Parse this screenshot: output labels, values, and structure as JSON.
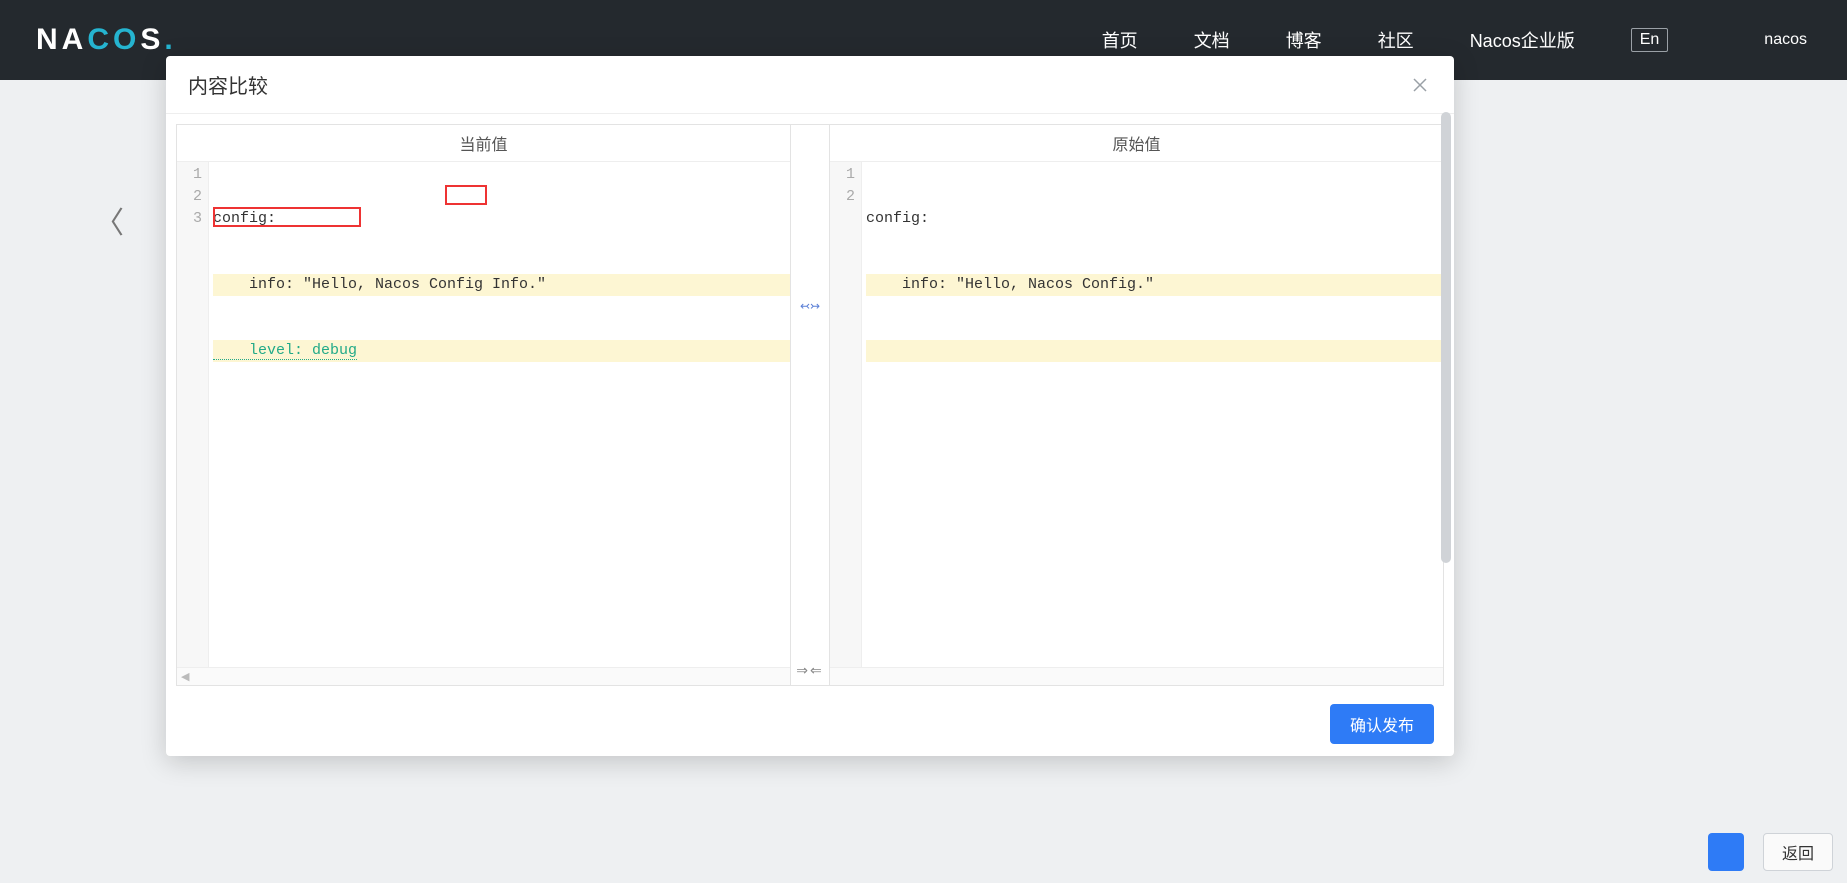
{
  "topbar": {
    "logo_left": "NA",
    "logo_mid": "CO",
    "logo_right": "S",
    "logo_dot": ".",
    "nav": {
      "home": "首页",
      "docs": "文档",
      "blog": "博客",
      "community": "社区",
      "enterprise": "Nacos企业版"
    },
    "lang": "En",
    "user": "nacos"
  },
  "page": {
    "back_icon": "〈",
    "bottom_blue_hidden": "",
    "bottom_back": "返回"
  },
  "modal": {
    "title": "内容比较",
    "left_header": "当前值",
    "right_header": "原始值",
    "publish": "确认发布",
    "center_marker_top": "↢↣",
    "center_marker_bottom": "⇒⇐"
  },
  "diff": {
    "left": {
      "lines": [
        {
          "n": "1",
          "text": "config:"
        },
        {
          "n": "2",
          "text": "    info: \"Hello, Nacos Config Info.\"",
          "hl": "yellow"
        },
        {
          "n": "3",
          "text": "    level: debug",
          "hl": "green",
          "inserted": true
        }
      ]
    },
    "right": {
      "lines": [
        {
          "n": "1",
          "text": "config:"
        },
        {
          "n": "2",
          "text": "    info: \"Hello, Nacos Config.\"",
          "hl": "yellow"
        },
        {
          "n": "",
          "text": "",
          "hl": "yellow"
        }
      ]
    }
  }
}
